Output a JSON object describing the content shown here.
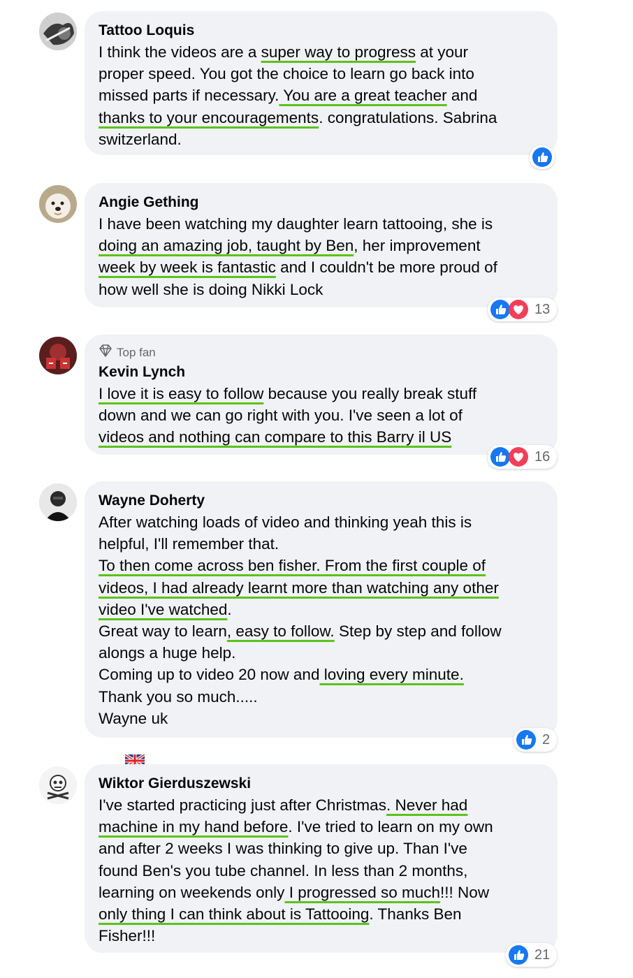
{
  "comments": [
    {
      "author": "Tattoo Loquis",
      "segments": [
        "I think the videos are a ",
        {
          "u": "super way to progress"
        },
        " at your\nproper speed. You got the choice to learn go back into\nmissed parts if necessary.",
        {
          "u": " You are a great teacher"
        },
        " and\n",
        {
          "u": "thanks to your encouragements"
        },
        ". congratulations. Sabrina\nswitzerland."
      ],
      "reaction_count": ""
    },
    {
      "author": "Angie Gething",
      "segments": [
        "I have been watching my daughter learn tattooing, she is\n",
        {
          "u": "doing an amazing job, taught by Ben"
        },
        ", her improvement\n",
        {
          "u": "week by week is fantastic"
        },
        " and I couldn't be more proud of\nhow well she is doing Nikki Lock"
      ],
      "reaction_count": "13"
    },
    {
      "badge": "Top fan",
      "author": "Kevin Lynch",
      "segments": [
        {
          "u": "I love it is easy to follow"
        },
        " because you really break stuff\ndown and we can go right with you. I've seen a lot of\n",
        {
          "u": "videos and nothing can compare to this Barry il US"
        }
      ],
      "reaction_count": "16"
    },
    {
      "author": "Wayne Doherty",
      "segments": [
        "After watching loads of video and thinking yeah this is\nhelpful, I'll remember that.\n",
        {
          "u": "To then come across ben fisher. From the first couple of"
        },
        "\n",
        {
          "u": "videos, I had already learnt more than watching any other"
        },
        "\n",
        {
          "u": "video I've watched"
        },
        ".\nGreat way to learn",
        {
          "u": ", easy to follow."
        },
        " Step by step and follow\nalongs a huge help.\nComing up to video 20 now and",
        {
          "u": " loving every minute."
        },
        "\nThank you so much.....\nWayne uk "
      ],
      "reaction_count": "2"
    },
    {
      "author": "Wiktor Gierduszewski",
      "segments": [
        "I've started practicing just after Christmas",
        {
          "u": ". Never had"
        },
        "\n",
        {
          "u": "machine in my hand before"
        },
        ". I've tried to learn on my own\nand after 2 weeks I was thinking to give up. Than I've\nfound Ben's you tube channel. In less than 2 months,\nlearning on weekends only",
        {
          "u": " I progressed so much"
        },
        "!!! Now\n",
        {
          "u": "only thing I can think about is Tattooing"
        },
        ". Thanks Ben\nFisher!!!"
      ],
      "reaction_count": "21"
    }
  ],
  "colors": {
    "bubble": "#f0f2f5",
    "underline": "#5cc21c",
    "like": "#1877f2",
    "love": "#f33e58"
  },
  "icons": {
    "like": "thumbs-up-icon",
    "love": "heart-icon",
    "badge": "diamond-icon"
  }
}
